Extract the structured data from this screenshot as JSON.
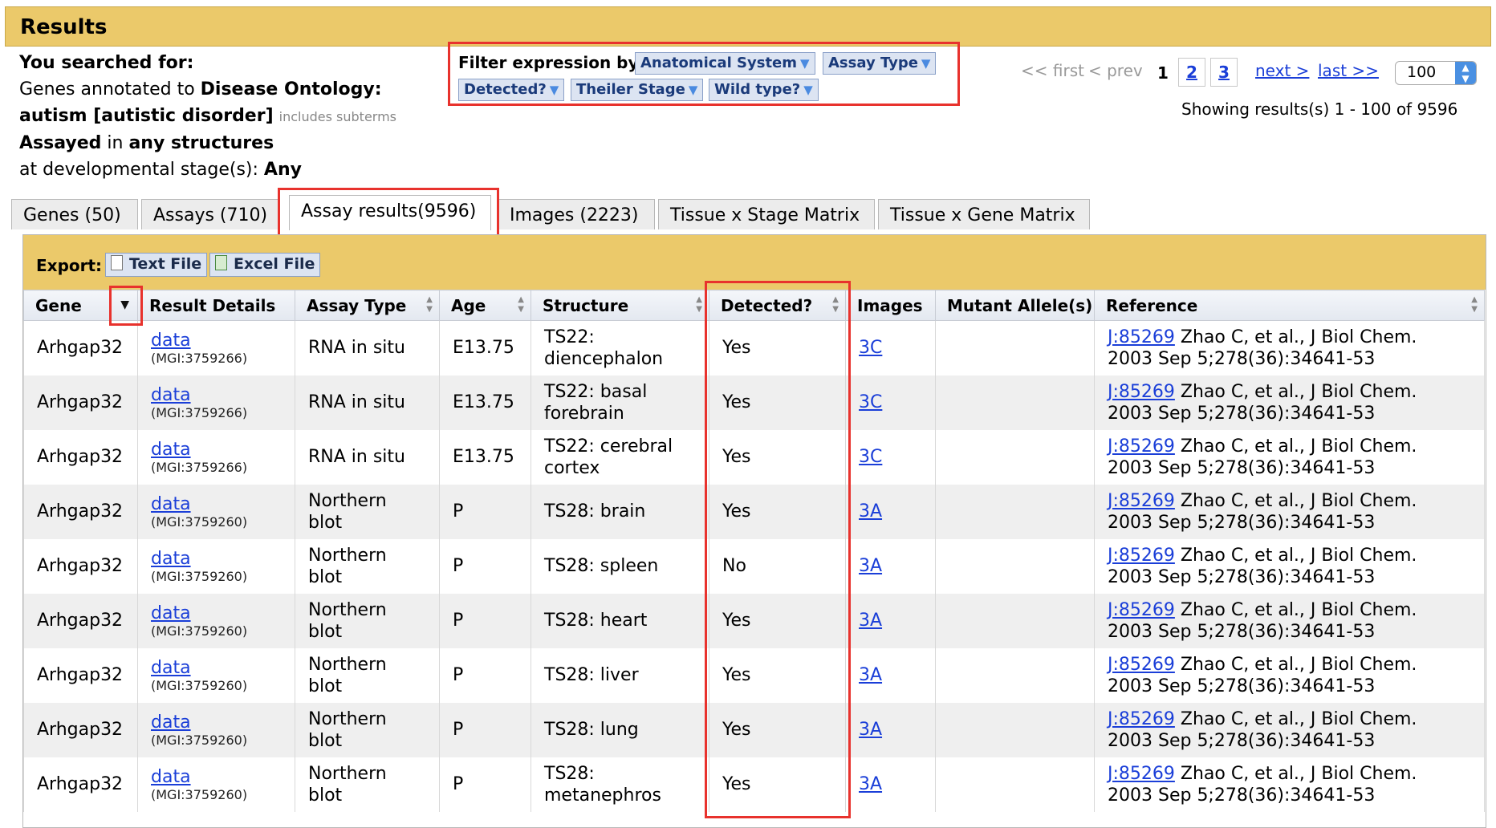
{
  "header": {
    "title": "Results"
  },
  "search": {
    "heading": "You searched for:",
    "line1_prefix": "Genes annotated to ",
    "line1_bold": "Disease Ontology:",
    "line2_bold": "autism [autistic disorder]",
    "line2_subterms": "includes subterms",
    "line3_bold1": "Assayed",
    "line3_mid": " in ",
    "line3_bold2": "any structures",
    "line4_prefix": "at developmental stage(s): ",
    "line4_bold": "Any"
  },
  "filter": {
    "label": "Filter expression by:",
    "buttons": [
      "Anatomical System",
      "Assay Type",
      "Detected?",
      "Theiler Stage",
      "Wild type?"
    ]
  },
  "pager": {
    "first": "<< first",
    "prev": "< prev",
    "current": "1",
    "pages": [
      "2",
      "3"
    ],
    "next": "next >",
    "last": "last >>",
    "page_size": "100",
    "showing": "Showing results(s) 1 - 100 of 9596"
  },
  "tabs": [
    {
      "label": "Genes (50)"
    },
    {
      "label": "Assays (710)"
    },
    {
      "label": "Assay results(9596)"
    },
    {
      "label": "Images (2223)"
    },
    {
      "label": "Tissue x Stage Matrix"
    },
    {
      "label": "Tissue x Gene Matrix"
    }
  ],
  "export": {
    "label": "Export:",
    "text_file": "Text File",
    "excel_file": "Excel File"
  },
  "table": {
    "columns": [
      "Gene",
      "Result Details",
      "Assay Type",
      "Age",
      "Structure",
      "Detected?",
      "Images",
      "Mutant Allele(s)",
      "Reference"
    ],
    "rows": [
      {
        "gene": "Arhgap32",
        "link": "data",
        "mgi": "(MGI:3759266)",
        "assay1": "RNA in situ",
        "assay2": "",
        "age": "E13.75",
        "struct1": "TS22:",
        "struct2": "diencephalon",
        "detected": "Yes",
        "image": "3C",
        "mutant": "",
        "ref_id": "J:85269",
        "ref1": " Zhao C, et al., J Biol Chem.",
        "ref2": "2003 Sep 5;278(36):34641-53"
      },
      {
        "gene": "Arhgap32",
        "link": "data",
        "mgi": "(MGI:3759266)",
        "assay1": "RNA in situ",
        "assay2": "",
        "age": "E13.75",
        "struct1": "TS22: basal",
        "struct2": "forebrain",
        "detected": "Yes",
        "image": "3C",
        "mutant": "",
        "ref_id": "J:85269",
        "ref1": " Zhao C, et al., J Biol Chem.",
        "ref2": "2003 Sep 5;278(36):34641-53"
      },
      {
        "gene": "Arhgap32",
        "link": "data",
        "mgi": "(MGI:3759266)",
        "assay1": "RNA in situ",
        "assay2": "",
        "age": "E13.75",
        "struct1": "TS22: cerebral",
        "struct2": "cortex",
        "detected": "Yes",
        "image": "3C",
        "mutant": "",
        "ref_id": "J:85269",
        "ref1": " Zhao C, et al., J Biol Chem.",
        "ref2": "2003 Sep 5;278(36):34641-53"
      },
      {
        "gene": "Arhgap32",
        "link": "data",
        "mgi": "(MGI:3759260)",
        "assay1": "Northern",
        "assay2": "blot",
        "age": "P",
        "struct1": "TS28: brain",
        "struct2": "",
        "detected": "Yes",
        "image": "3A",
        "mutant": "",
        "ref_id": "J:85269",
        "ref1": " Zhao C, et al., J Biol Chem.",
        "ref2": "2003 Sep 5;278(36):34641-53"
      },
      {
        "gene": "Arhgap32",
        "link": "data",
        "mgi": "(MGI:3759260)",
        "assay1": "Northern",
        "assay2": "blot",
        "age": "P",
        "struct1": "TS28: spleen",
        "struct2": "",
        "detected": "No",
        "image": "3A",
        "mutant": "",
        "ref_id": "J:85269",
        "ref1": " Zhao C, et al., J Biol Chem.",
        "ref2": "2003 Sep 5;278(36):34641-53"
      },
      {
        "gene": "Arhgap32",
        "link": "data",
        "mgi": "(MGI:3759260)",
        "assay1": "Northern",
        "assay2": "blot",
        "age": "P",
        "struct1": "TS28: heart",
        "struct2": "",
        "detected": "Yes",
        "image": "3A",
        "mutant": "",
        "ref_id": "J:85269",
        "ref1": " Zhao C, et al., J Biol Chem.",
        "ref2": "2003 Sep 5;278(36):34641-53"
      },
      {
        "gene": "Arhgap32",
        "link": "data",
        "mgi": "(MGI:3759260)",
        "assay1": "Northern",
        "assay2": "blot",
        "age": "P",
        "struct1": "TS28: liver",
        "struct2": "",
        "detected": "Yes",
        "image": "3A",
        "mutant": "",
        "ref_id": "J:85269",
        "ref1": " Zhao C, et al., J Biol Chem.",
        "ref2": "2003 Sep 5;278(36):34641-53"
      },
      {
        "gene": "Arhgap32",
        "link": "data",
        "mgi": "(MGI:3759260)",
        "assay1": "Northern",
        "assay2": "blot",
        "age": "P",
        "struct1": "TS28: lung",
        "struct2": "",
        "detected": "Yes",
        "image": "3A",
        "mutant": "",
        "ref_id": "J:85269",
        "ref1": " Zhao C, et al., J Biol Chem.",
        "ref2": "2003 Sep 5;278(36):34641-53"
      },
      {
        "gene": "Arhgap32",
        "link": "data",
        "mgi": "(MGI:3759260)",
        "assay1": "Northern",
        "assay2": "blot",
        "age": "P",
        "struct1": "TS28:",
        "struct2": "metanephros",
        "detected": "Yes",
        "image": "3A",
        "mutant": "",
        "ref_id": "J:85269",
        "ref1": " Zhao C, et al., J Biol Chem.",
        "ref2": "2003 Sep 5;278(36):34641-53"
      }
    ]
  },
  "colors": {
    "header_bg": "#ebc96a",
    "highlight": "#e8322d",
    "link": "#1a3ed8",
    "filter_btn_bg": "#dce4f2"
  }
}
